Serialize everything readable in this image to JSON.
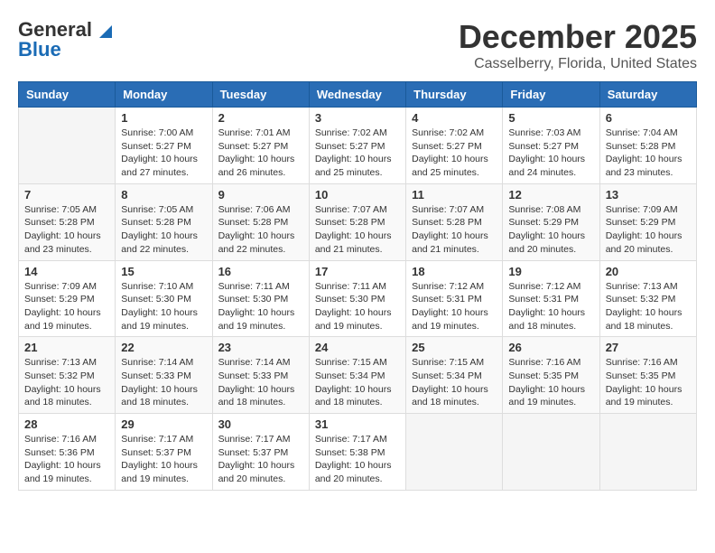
{
  "header": {
    "logo_line1": "General",
    "logo_line2": "Blue",
    "month": "December 2025",
    "location": "Casselberry, Florida, United States"
  },
  "weekdays": [
    "Sunday",
    "Monday",
    "Tuesday",
    "Wednesday",
    "Thursday",
    "Friday",
    "Saturday"
  ],
  "weeks": [
    [
      {
        "day": "",
        "sunrise": "",
        "sunset": "",
        "daylight": ""
      },
      {
        "day": "1",
        "sunrise": "Sunrise: 7:00 AM",
        "sunset": "Sunset: 5:27 PM",
        "daylight": "Daylight: 10 hours and 27 minutes."
      },
      {
        "day": "2",
        "sunrise": "Sunrise: 7:01 AM",
        "sunset": "Sunset: 5:27 PM",
        "daylight": "Daylight: 10 hours and 26 minutes."
      },
      {
        "day": "3",
        "sunrise": "Sunrise: 7:02 AM",
        "sunset": "Sunset: 5:27 PM",
        "daylight": "Daylight: 10 hours and 25 minutes."
      },
      {
        "day": "4",
        "sunrise": "Sunrise: 7:02 AM",
        "sunset": "Sunset: 5:27 PM",
        "daylight": "Daylight: 10 hours and 25 minutes."
      },
      {
        "day": "5",
        "sunrise": "Sunrise: 7:03 AM",
        "sunset": "Sunset: 5:27 PM",
        "daylight": "Daylight: 10 hours and 24 minutes."
      },
      {
        "day": "6",
        "sunrise": "Sunrise: 7:04 AM",
        "sunset": "Sunset: 5:28 PM",
        "daylight": "Daylight: 10 hours and 23 minutes."
      }
    ],
    [
      {
        "day": "7",
        "sunrise": "Sunrise: 7:05 AM",
        "sunset": "Sunset: 5:28 PM",
        "daylight": "Daylight: 10 hours and 23 minutes."
      },
      {
        "day": "8",
        "sunrise": "Sunrise: 7:05 AM",
        "sunset": "Sunset: 5:28 PM",
        "daylight": "Daylight: 10 hours and 22 minutes."
      },
      {
        "day": "9",
        "sunrise": "Sunrise: 7:06 AM",
        "sunset": "Sunset: 5:28 PM",
        "daylight": "Daylight: 10 hours and 22 minutes."
      },
      {
        "day": "10",
        "sunrise": "Sunrise: 7:07 AM",
        "sunset": "Sunset: 5:28 PM",
        "daylight": "Daylight: 10 hours and 21 minutes."
      },
      {
        "day": "11",
        "sunrise": "Sunrise: 7:07 AM",
        "sunset": "Sunset: 5:28 PM",
        "daylight": "Daylight: 10 hours and 21 minutes."
      },
      {
        "day": "12",
        "sunrise": "Sunrise: 7:08 AM",
        "sunset": "Sunset: 5:29 PM",
        "daylight": "Daylight: 10 hours and 20 minutes."
      },
      {
        "day": "13",
        "sunrise": "Sunrise: 7:09 AM",
        "sunset": "Sunset: 5:29 PM",
        "daylight": "Daylight: 10 hours and 20 minutes."
      }
    ],
    [
      {
        "day": "14",
        "sunrise": "Sunrise: 7:09 AM",
        "sunset": "Sunset: 5:29 PM",
        "daylight": "Daylight: 10 hours and 19 minutes."
      },
      {
        "day": "15",
        "sunrise": "Sunrise: 7:10 AM",
        "sunset": "Sunset: 5:30 PM",
        "daylight": "Daylight: 10 hours and 19 minutes."
      },
      {
        "day": "16",
        "sunrise": "Sunrise: 7:11 AM",
        "sunset": "Sunset: 5:30 PM",
        "daylight": "Daylight: 10 hours and 19 minutes."
      },
      {
        "day": "17",
        "sunrise": "Sunrise: 7:11 AM",
        "sunset": "Sunset: 5:30 PM",
        "daylight": "Daylight: 10 hours and 19 minutes."
      },
      {
        "day": "18",
        "sunrise": "Sunrise: 7:12 AM",
        "sunset": "Sunset: 5:31 PM",
        "daylight": "Daylight: 10 hours and 19 minutes."
      },
      {
        "day": "19",
        "sunrise": "Sunrise: 7:12 AM",
        "sunset": "Sunset: 5:31 PM",
        "daylight": "Daylight: 10 hours and 18 minutes."
      },
      {
        "day": "20",
        "sunrise": "Sunrise: 7:13 AM",
        "sunset": "Sunset: 5:32 PM",
        "daylight": "Daylight: 10 hours and 18 minutes."
      }
    ],
    [
      {
        "day": "21",
        "sunrise": "Sunrise: 7:13 AM",
        "sunset": "Sunset: 5:32 PM",
        "daylight": "Daylight: 10 hours and 18 minutes."
      },
      {
        "day": "22",
        "sunrise": "Sunrise: 7:14 AM",
        "sunset": "Sunset: 5:33 PM",
        "daylight": "Daylight: 10 hours and 18 minutes."
      },
      {
        "day": "23",
        "sunrise": "Sunrise: 7:14 AM",
        "sunset": "Sunset: 5:33 PM",
        "daylight": "Daylight: 10 hours and 18 minutes."
      },
      {
        "day": "24",
        "sunrise": "Sunrise: 7:15 AM",
        "sunset": "Sunset: 5:34 PM",
        "daylight": "Daylight: 10 hours and 18 minutes."
      },
      {
        "day": "25",
        "sunrise": "Sunrise: 7:15 AM",
        "sunset": "Sunset: 5:34 PM",
        "daylight": "Daylight: 10 hours and 18 minutes."
      },
      {
        "day": "26",
        "sunrise": "Sunrise: 7:16 AM",
        "sunset": "Sunset: 5:35 PM",
        "daylight": "Daylight: 10 hours and 19 minutes."
      },
      {
        "day": "27",
        "sunrise": "Sunrise: 7:16 AM",
        "sunset": "Sunset: 5:35 PM",
        "daylight": "Daylight: 10 hours and 19 minutes."
      }
    ],
    [
      {
        "day": "28",
        "sunrise": "Sunrise: 7:16 AM",
        "sunset": "Sunset: 5:36 PM",
        "daylight": "Daylight: 10 hours and 19 minutes."
      },
      {
        "day": "29",
        "sunrise": "Sunrise: 7:17 AM",
        "sunset": "Sunset: 5:37 PM",
        "daylight": "Daylight: 10 hours and 19 minutes."
      },
      {
        "day": "30",
        "sunrise": "Sunrise: 7:17 AM",
        "sunset": "Sunset: 5:37 PM",
        "daylight": "Daylight: 10 hours and 20 minutes."
      },
      {
        "day": "31",
        "sunrise": "Sunrise: 7:17 AM",
        "sunset": "Sunset: 5:38 PM",
        "daylight": "Daylight: 10 hours and 20 minutes."
      },
      {
        "day": "",
        "sunrise": "",
        "sunset": "",
        "daylight": ""
      },
      {
        "day": "",
        "sunrise": "",
        "sunset": "",
        "daylight": ""
      },
      {
        "day": "",
        "sunrise": "",
        "sunset": "",
        "daylight": ""
      }
    ]
  ]
}
